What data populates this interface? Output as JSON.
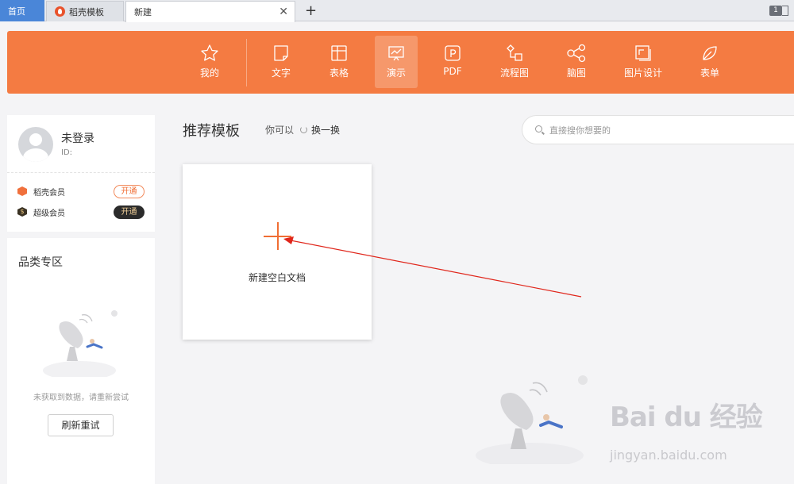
{
  "tabs": {
    "home": "首页",
    "template": "稻壳模板",
    "new": "新建",
    "close": "✕",
    "add": "+",
    "window_count": "1"
  },
  "toolbar": {
    "items": [
      {
        "label": "我的",
        "icon": "star-icon"
      },
      {
        "label": "文字",
        "icon": "document-icon"
      },
      {
        "label": "表格",
        "icon": "table-icon"
      },
      {
        "label": "演示",
        "icon": "presentation-icon",
        "active": true
      },
      {
        "label": "PDF",
        "icon": "pdf-icon"
      },
      {
        "label": "流程图",
        "icon": "flowchart-icon"
      },
      {
        "label": "脑图",
        "icon": "mindmap-icon"
      },
      {
        "label": "图片设计",
        "icon": "image-design-icon"
      },
      {
        "label": "表单",
        "icon": "form-leaf-icon"
      }
    ],
    "accent": "#f47b42"
  },
  "user": {
    "name": "未登录",
    "id_label": "ID:",
    "memberships": [
      {
        "label": "稻壳会员",
        "button": "开通"
      },
      {
        "label": "超级会员",
        "button": "开通"
      }
    ]
  },
  "category": {
    "title": "品类专区",
    "empty_text": "未获取到数据，请重新尝试",
    "retry": "刷新重试"
  },
  "main": {
    "title": "推荐模板",
    "hint": "你可以",
    "refresh": "换一换",
    "search_placeholder": "直接搜你想要的",
    "new_blank": "新建空白文档"
  },
  "watermark": {
    "logo": "Bai du 经验",
    "url": "jingyan.baidu.com"
  }
}
